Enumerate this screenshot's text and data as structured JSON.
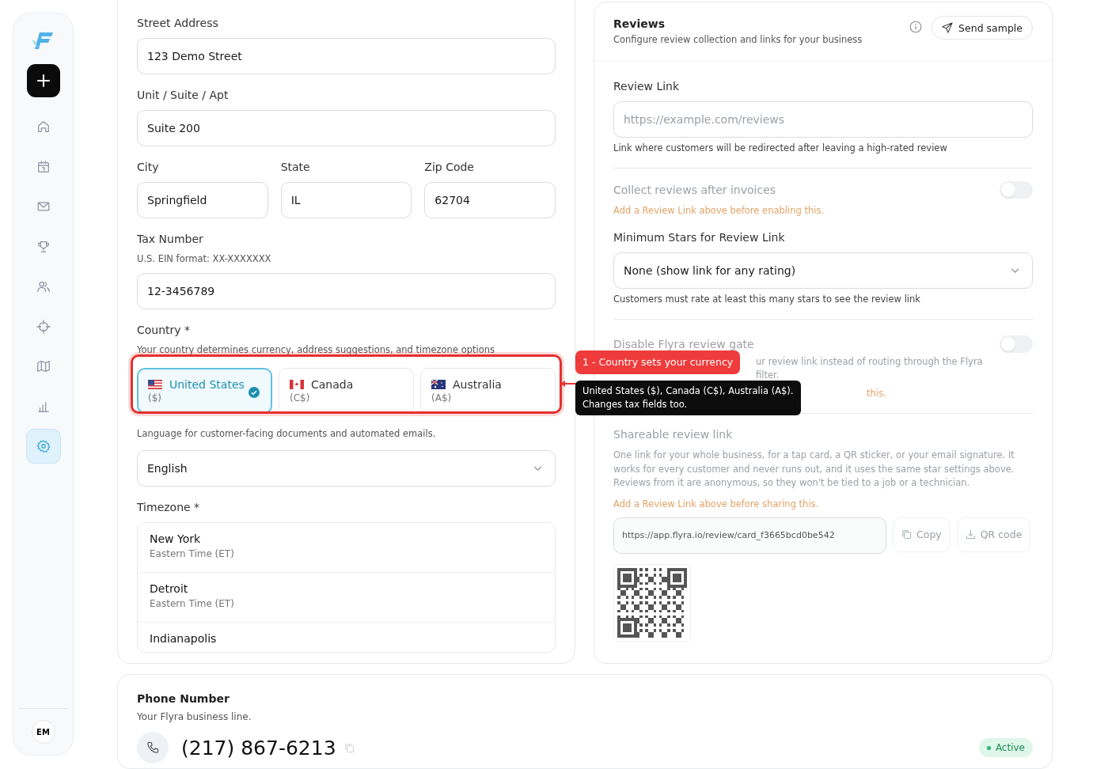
{
  "sidebar": {
    "items": [
      {
        "selected": false
      },
      {
        "selected": false
      },
      {
        "selected": false
      },
      {
        "selected": false
      },
      {
        "selected": false
      },
      {
        "selected": false
      },
      {
        "selected": false
      },
      {
        "selected": false
      },
      {
        "selected": true
      }
    ],
    "avatar": "EM"
  },
  "address": {
    "street": {
      "label": "Street Address",
      "value": "123 Demo Street"
    },
    "unit": {
      "label": "Unit / Suite / Apt",
      "value": "Suite 200"
    },
    "city": {
      "label": "City",
      "value": "Springfield"
    },
    "state": {
      "label": "State",
      "value": "IL"
    },
    "zip": {
      "label": "Zip Code",
      "value": "62704"
    },
    "tax": {
      "label": "Tax Number",
      "hint": "U.S. EIN format: XX-XXXXXXX",
      "value": "12-3456789"
    },
    "country": {
      "label": "Country *",
      "hint": "Your country determines currency, address suggestions, and timezone options",
      "options": [
        {
          "name": "United States",
          "currency": "($)",
          "selected": true
        },
        {
          "name": "Canada",
          "currency": "(C$)",
          "selected": false
        },
        {
          "name": "Australia",
          "currency": "(A$)",
          "selected": false
        }
      ]
    },
    "language": {
      "hint": "Language for customer-facing documents and automated emails.",
      "value": "English"
    },
    "timezone": {
      "label": "Timezone *",
      "options": [
        {
          "city": "New York",
          "zone": "Eastern Time (ET)"
        },
        {
          "city": "Detroit",
          "zone": "Eastern Time (ET)"
        },
        {
          "city": "Indianapolis"
        }
      ]
    }
  },
  "reviews": {
    "title": "Reviews",
    "subtitle": "Configure review collection and links for your business",
    "send_button": "Send sample",
    "review_link": {
      "label": "Review Link",
      "placeholder": "https://example.com/reviews",
      "hint": "Link where customers will be redirected after leaving a high-rated review"
    },
    "collect": {
      "label": "Collect reviews after invoices",
      "on": false,
      "disabled": true,
      "warning": "Add a Review Link above before enabling this."
    },
    "min_stars": {
      "label": "Minimum Stars for Review Link",
      "value": "None (show link for any rating)",
      "hint": "Customers must rate at least this many stars to see the review link"
    },
    "gate": {
      "label": "Disable Flyra review gate",
      "on": false,
      "disabled": true,
      "description_lines": [
        "ur review link instead of routing through the Flyra",
        "filter."
      ],
      "warning": "this."
    },
    "shareable": {
      "label": "Shareable review link",
      "disabled": true,
      "description": "One link for your whole business, for a tap card, a QR sticker, or your email signature. It works for every customer and never runs out, and it uses the same star settings above. Reviews from it are anonymous, so they won't be tied to a job or a technician.",
      "warning": "Add a Review Link above before sharing this.",
      "url": "https://app.flyra.io/review/card_f3665bcd0be542",
      "copy_button": "Copy",
      "qr_button": "QR code"
    }
  },
  "annotation": {
    "callout": "1 - Country sets your currency",
    "tooltip_lines": [
      "United States ($), Canada (C$), Australia (A$).",
      "Changes tax fields too."
    ]
  },
  "phone": {
    "title": "Phone Number",
    "subtitle": "Your Flyra business line.",
    "number": "(217) 867-6213",
    "status": "Active"
  }
}
